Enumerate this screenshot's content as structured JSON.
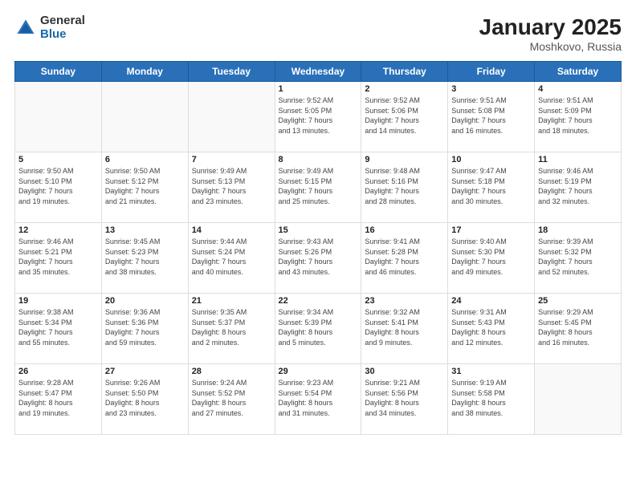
{
  "logo": {
    "general": "General",
    "blue": "Blue"
  },
  "title": "January 2025",
  "subtitle": "Moshkovo, Russia",
  "headers": [
    "Sunday",
    "Monday",
    "Tuesday",
    "Wednesday",
    "Thursday",
    "Friday",
    "Saturday"
  ],
  "weeks": [
    [
      {
        "day": "",
        "info": ""
      },
      {
        "day": "",
        "info": ""
      },
      {
        "day": "",
        "info": ""
      },
      {
        "day": "1",
        "info": "Sunrise: 9:52 AM\nSunset: 5:05 PM\nDaylight: 7 hours\nand 13 minutes."
      },
      {
        "day": "2",
        "info": "Sunrise: 9:52 AM\nSunset: 5:06 PM\nDaylight: 7 hours\nand 14 minutes."
      },
      {
        "day": "3",
        "info": "Sunrise: 9:51 AM\nSunset: 5:08 PM\nDaylight: 7 hours\nand 16 minutes."
      },
      {
        "day": "4",
        "info": "Sunrise: 9:51 AM\nSunset: 5:09 PM\nDaylight: 7 hours\nand 18 minutes."
      }
    ],
    [
      {
        "day": "5",
        "info": "Sunrise: 9:50 AM\nSunset: 5:10 PM\nDaylight: 7 hours\nand 19 minutes."
      },
      {
        "day": "6",
        "info": "Sunrise: 9:50 AM\nSunset: 5:12 PM\nDaylight: 7 hours\nand 21 minutes."
      },
      {
        "day": "7",
        "info": "Sunrise: 9:49 AM\nSunset: 5:13 PM\nDaylight: 7 hours\nand 23 minutes."
      },
      {
        "day": "8",
        "info": "Sunrise: 9:49 AM\nSunset: 5:15 PM\nDaylight: 7 hours\nand 25 minutes."
      },
      {
        "day": "9",
        "info": "Sunrise: 9:48 AM\nSunset: 5:16 PM\nDaylight: 7 hours\nand 28 minutes."
      },
      {
        "day": "10",
        "info": "Sunrise: 9:47 AM\nSunset: 5:18 PM\nDaylight: 7 hours\nand 30 minutes."
      },
      {
        "day": "11",
        "info": "Sunrise: 9:46 AM\nSunset: 5:19 PM\nDaylight: 7 hours\nand 32 minutes."
      }
    ],
    [
      {
        "day": "12",
        "info": "Sunrise: 9:46 AM\nSunset: 5:21 PM\nDaylight: 7 hours\nand 35 minutes."
      },
      {
        "day": "13",
        "info": "Sunrise: 9:45 AM\nSunset: 5:23 PM\nDaylight: 7 hours\nand 38 minutes."
      },
      {
        "day": "14",
        "info": "Sunrise: 9:44 AM\nSunset: 5:24 PM\nDaylight: 7 hours\nand 40 minutes."
      },
      {
        "day": "15",
        "info": "Sunrise: 9:43 AM\nSunset: 5:26 PM\nDaylight: 7 hours\nand 43 minutes."
      },
      {
        "day": "16",
        "info": "Sunrise: 9:41 AM\nSunset: 5:28 PM\nDaylight: 7 hours\nand 46 minutes."
      },
      {
        "day": "17",
        "info": "Sunrise: 9:40 AM\nSunset: 5:30 PM\nDaylight: 7 hours\nand 49 minutes."
      },
      {
        "day": "18",
        "info": "Sunrise: 9:39 AM\nSunset: 5:32 PM\nDaylight: 7 hours\nand 52 minutes."
      }
    ],
    [
      {
        "day": "19",
        "info": "Sunrise: 9:38 AM\nSunset: 5:34 PM\nDaylight: 7 hours\nand 55 minutes."
      },
      {
        "day": "20",
        "info": "Sunrise: 9:36 AM\nSunset: 5:36 PM\nDaylight: 7 hours\nand 59 minutes."
      },
      {
        "day": "21",
        "info": "Sunrise: 9:35 AM\nSunset: 5:37 PM\nDaylight: 8 hours\nand 2 minutes."
      },
      {
        "day": "22",
        "info": "Sunrise: 9:34 AM\nSunset: 5:39 PM\nDaylight: 8 hours\nand 5 minutes."
      },
      {
        "day": "23",
        "info": "Sunrise: 9:32 AM\nSunset: 5:41 PM\nDaylight: 8 hours\nand 9 minutes."
      },
      {
        "day": "24",
        "info": "Sunrise: 9:31 AM\nSunset: 5:43 PM\nDaylight: 8 hours\nand 12 minutes."
      },
      {
        "day": "25",
        "info": "Sunrise: 9:29 AM\nSunset: 5:45 PM\nDaylight: 8 hours\nand 16 minutes."
      }
    ],
    [
      {
        "day": "26",
        "info": "Sunrise: 9:28 AM\nSunset: 5:47 PM\nDaylight: 8 hours\nand 19 minutes."
      },
      {
        "day": "27",
        "info": "Sunrise: 9:26 AM\nSunset: 5:50 PM\nDaylight: 8 hours\nand 23 minutes."
      },
      {
        "day": "28",
        "info": "Sunrise: 9:24 AM\nSunset: 5:52 PM\nDaylight: 8 hours\nand 27 minutes."
      },
      {
        "day": "29",
        "info": "Sunrise: 9:23 AM\nSunset: 5:54 PM\nDaylight: 8 hours\nand 31 minutes."
      },
      {
        "day": "30",
        "info": "Sunrise: 9:21 AM\nSunset: 5:56 PM\nDaylight: 8 hours\nand 34 minutes."
      },
      {
        "day": "31",
        "info": "Sunrise: 9:19 AM\nSunset: 5:58 PM\nDaylight: 8 hours\nand 38 minutes."
      },
      {
        "day": "",
        "info": ""
      }
    ]
  ]
}
